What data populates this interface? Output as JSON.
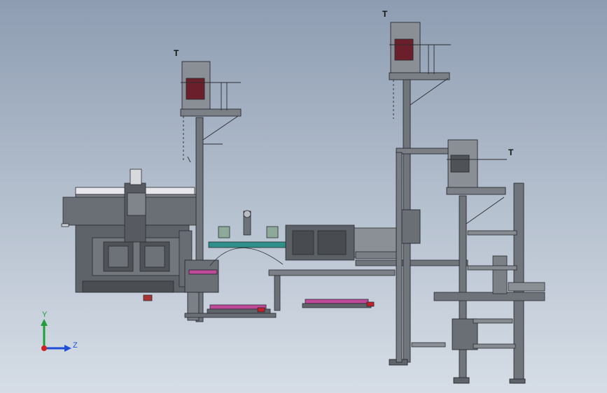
{
  "scene": {
    "background_top": "#8e9db2",
    "background_bottom": "#d6dde6",
    "steel_color": "#5f646b",
    "edge_color": "#2a2c30",
    "magenta_accent": "#c04a9a",
    "teal_accent": "#2f8f8a",
    "red_accent": "#c21f2a"
  },
  "markers": {
    "tower1": "T",
    "tower2": "T",
    "tower3": "T"
  },
  "triad": {
    "y_label": "Y",
    "z_label": "Z",
    "y_color": "#1f9e3a",
    "z_color": "#1f4fd6",
    "x_color": "#d02020"
  }
}
